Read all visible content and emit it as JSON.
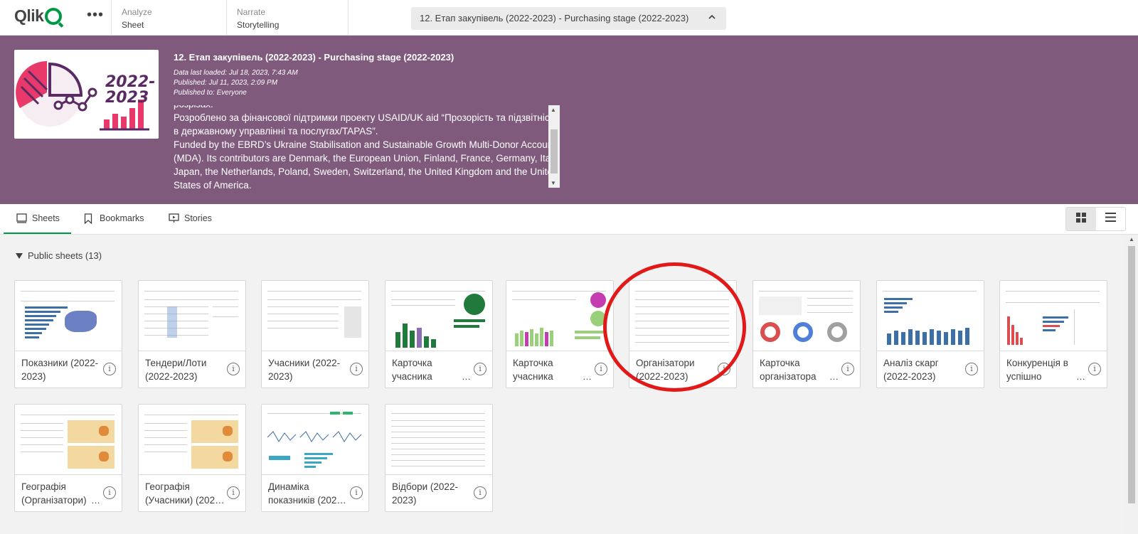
{
  "topbar": {
    "logo_text": "Qlik",
    "more": "•••",
    "analyze": {
      "label": "Analyze",
      "value": "Sheet"
    },
    "narrate": {
      "label": "Narrate",
      "value": "Storytelling"
    },
    "app_title": "12. Етап закупівель (2022-2023) - Purchasing stage (2022-2023)"
  },
  "header": {
    "logo_text": "2022-\n2023",
    "title": "12. Етап закупівель (2022-2023) - Purchasing stage (2022-2023)",
    "data_loaded": "Data last loaded: Jul 18, 2023, 7:43 AM",
    "published": "Published: Jul 11, 2023, 2:09 PM",
    "published_to": "Published to: Everyone",
    "description": [
      "розрізах.",
      "Розроблено за фінансової підтримки проекту USAID/UK aid “Прозорість та підзвітність в державному управлінні та послугах/TAPAS”.",
      "Funded by the EBRD’s Ukraine Stabilisation and Sustainable Growth Multi-Donor Account (MDA). Its contributors are Denmark, the European Union, Finland, France, Germany, Italy, Japan, the Netherlands, Poland, Sweden, Switzerland, the United Kingdom and the United States of America."
    ]
  },
  "tabs": {
    "sheets": "Sheets",
    "bookmarks": "Bookmarks",
    "stories": "Stories"
  },
  "section": {
    "label": "Public sheets (13)"
  },
  "cards": [
    {
      "title": "Показники (2022-2023)",
      "dots": false
    },
    {
      "title": "Тендери/Лоти (2022-2023)",
      "dots": false
    },
    {
      "title": "Учасники (2022-2023)",
      "dots": false
    },
    {
      "title": "Карточка учасника",
      "dots": true
    },
    {
      "title": "Карточка учасника",
      "dots": true
    },
    {
      "title": "Організатори (2022-2023)",
      "dots": false
    },
    {
      "title": "Карточка організатора",
      "dots": true
    },
    {
      "title": "Аналіз скарг (2022-2023)",
      "dots": false
    },
    {
      "title": "Конкуренція в успішно",
      "dots": true
    },
    {
      "title": "Географія (Організатори)",
      "dots": true
    },
    {
      "title": "Географія (Учасники) (202…",
      "dots": false
    },
    {
      "title": "Динаміка показників (202…",
      "dots": false
    },
    {
      "title": "Відбори (2022-2023)",
      "dots": false
    }
  ],
  "colors": {
    "header_bg": "#7f5a7c",
    "accent_green": "#009845",
    "highlight_circle": "#e11919",
    "chart_blue": "#3a6fa8"
  }
}
